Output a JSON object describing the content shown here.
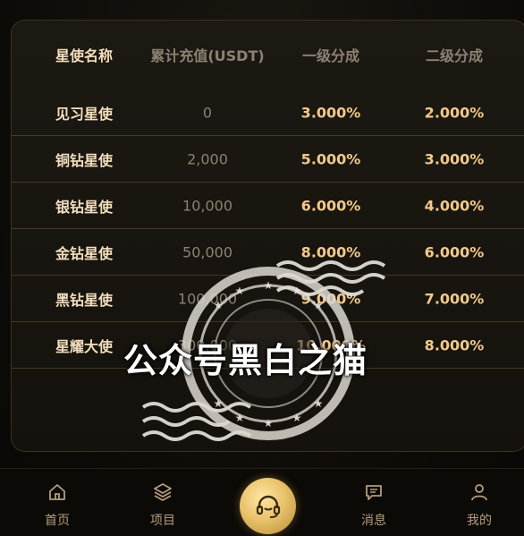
{
  "table": {
    "headers": [
      "星使名称",
      "累计充值(USDT)",
      "一级分成",
      "二级分成"
    ],
    "rows": [
      [
        "见习星使",
        "0",
        "3.000%",
        "2.000%"
      ],
      [
        "铜钻星使",
        "2,000",
        "5.000%",
        "3.000%"
      ],
      [
        "银钻星使",
        "10,000",
        "6.000%",
        "4.000%"
      ],
      [
        "金钻星使",
        "50,000",
        "8.000%",
        "6.000%"
      ],
      [
        "黑钻星使",
        "100,000",
        "9.000%",
        "7.000%"
      ],
      [
        "星耀大使",
        "300,000",
        "10.000%",
        "8.000%"
      ]
    ]
  },
  "watermark": {
    "text": "公众号黑白之猫"
  },
  "nav": {
    "items": [
      {
        "label": "首页",
        "icon": "home-icon"
      },
      {
        "label": "项目",
        "icon": "layers-icon"
      },
      {
        "label": "",
        "icon": "headset-icon"
      },
      {
        "label": "消息",
        "icon": "message-icon"
      },
      {
        "label": "我的",
        "icon": "user-icon"
      }
    ]
  },
  "colors": {
    "gold": "#f1c98a",
    "muted": "#8d8272",
    "background": "#0b0906"
  }
}
